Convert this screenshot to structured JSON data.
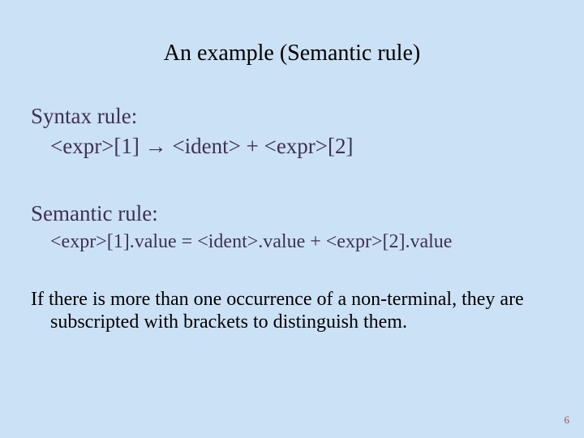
{
  "title": "An example (Semantic rule)",
  "syntax": {
    "heading": "Syntax rule:",
    "lhs": "<expr>[1]",
    "arrow": "→",
    "rhs": "<ident> + <expr>[2]"
  },
  "semantic": {
    "heading": "Semantic rule:",
    "rule": "<expr>[1].value =  <ident>.value + <expr>[2].value"
  },
  "note": "If there is more than one occurrence of a non-terminal, they are subscripted with brackets to distinguish them.",
  "page_number": "6"
}
